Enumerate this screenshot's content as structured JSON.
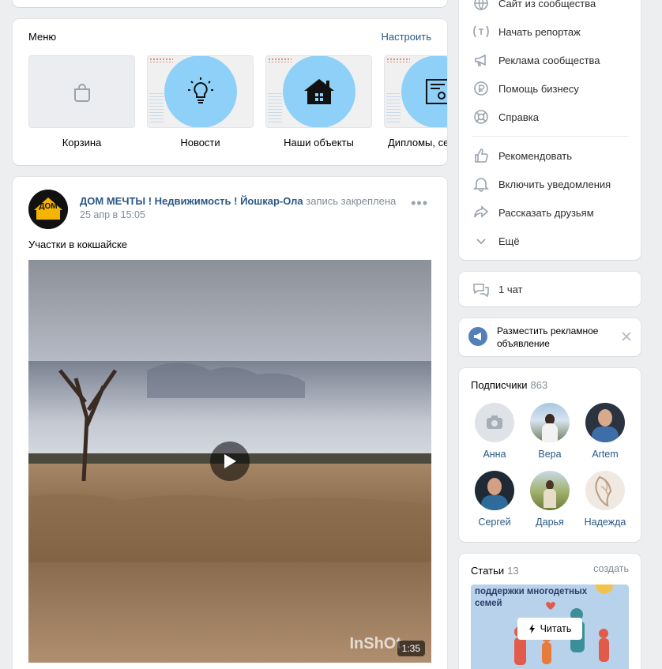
{
  "menu": {
    "title": "Меню",
    "configure": "Настроить",
    "tiles": [
      {
        "label": "Корзина",
        "icon": "shopping-bag-icon"
      },
      {
        "label": "Новости",
        "icon": "lightbulb-icon"
      },
      {
        "label": "Наши объекты",
        "icon": "house-icon"
      },
      {
        "label": "Дипломы, се",
        "icon": "certificate-icon"
      }
    ]
  },
  "post": {
    "author": "ДОМ МЕЧТЫ ! Недвижимость ! Йошкар-Ола",
    "pinned_note": "запись закреплена",
    "date": "25 апр в 15:05",
    "text": "Участки в кокшайске",
    "more": "•••",
    "video": {
      "duration": "1:35",
      "watermark": "InShOt"
    },
    "avatar_text": "ДОМ"
  },
  "actions": {
    "items": [
      {
        "label": "Сайт из сообщества",
        "icon": "globe-icon"
      },
      {
        "label": "Начать репортаж",
        "icon": "live-icon"
      },
      {
        "label": "Реклама сообщества",
        "icon": "megaphone-icon"
      },
      {
        "label": "Помощь бизнесу",
        "icon": "ruble-icon"
      },
      {
        "label": "Справка",
        "icon": "lifebuoy-icon"
      },
      {
        "label": "Рекомендовать",
        "icon": "thumbs-up-icon"
      },
      {
        "label": "Включить уведомления",
        "icon": "bell-icon"
      },
      {
        "label": "Рассказать друзьям",
        "icon": "share-icon"
      },
      {
        "label": "Ещё",
        "icon": "chevron-down-icon"
      }
    ]
  },
  "chat": {
    "label": "1 чат"
  },
  "ad": {
    "label": "Разместить рекламное объявление"
  },
  "subscribers": {
    "title": "Подписчики",
    "count": "863",
    "people": [
      {
        "name": "Анна"
      },
      {
        "name": "Вера"
      },
      {
        "name": "Artem"
      },
      {
        "name": "Сергей"
      },
      {
        "name": "Дарья"
      },
      {
        "name": "Надежда"
      }
    ]
  },
  "articles": {
    "title": "Статьи",
    "count": "13",
    "create": "создать",
    "cover_text": "поддержки многодетных семей",
    "read": "Читать"
  },
  "colors": {
    "accent": "#2a5885",
    "bg": "#edeef0",
    "tile_circle": "#8fd0f8"
  }
}
